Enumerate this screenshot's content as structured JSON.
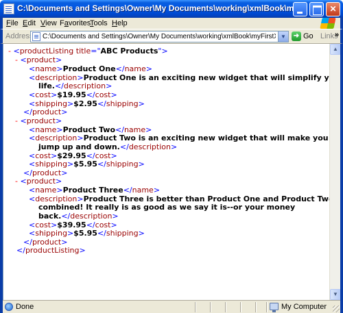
{
  "window": {
    "title": "C:\\Documents and Settings\\Owner\\My Documents\\working\\xmlBook\\myFirstXML.xml - Micr..."
  },
  "menu": {
    "file": {
      "ul": "F",
      "rest": "ile"
    },
    "edit": {
      "ul": "E",
      "rest": "dit"
    },
    "view": {
      "ul": "V",
      "rest": "iew"
    },
    "favorites": {
      "pre": "F",
      "ul": "a",
      "rest": "vorites"
    },
    "tools": {
      "ul": "T",
      "rest": "ools"
    },
    "help": {
      "ul": "H",
      "rest": "elp"
    }
  },
  "address_bar": {
    "label": "Address",
    "url": "C:\\Documents and Settings\\Owner\\My Documents\\working\\xmlBook\\myFirstXML.xml",
    "go_label": "Go",
    "links_label": "Links",
    "links_chevron": "»"
  },
  "xml": {
    "minus": "-",
    "root_tag": "productListing",
    "root_attr_name": "title",
    "root_attr_value": "ABC Products",
    "product_tag": "product",
    "name_tag": "name",
    "description_tag": "description",
    "cost_tag": "cost",
    "shipping_tag": "shipping",
    "products": [
      {
        "name": "Product One",
        "description_lines": [
          "Product One is an exciting new widget that will simplify your",
          "life."
        ],
        "cost": "$19.95",
        "shipping": "$2.95"
      },
      {
        "name": "Product Two",
        "description_lines": [
          "Product Two is an exciting new widget that will make you",
          "jump up and down."
        ],
        "cost": "$29.95",
        "shipping": "$5.95"
      },
      {
        "name": "Product Three",
        "description_lines": [
          "Product Three is better than Product One and Product Two",
          "combined! It really is as good as we say it is--or your money",
          "back."
        ],
        "cost": "$39.95",
        "shipping": "$5.95"
      }
    ]
  },
  "status_bar": {
    "status": "Done",
    "zone": "My Computer"
  }
}
